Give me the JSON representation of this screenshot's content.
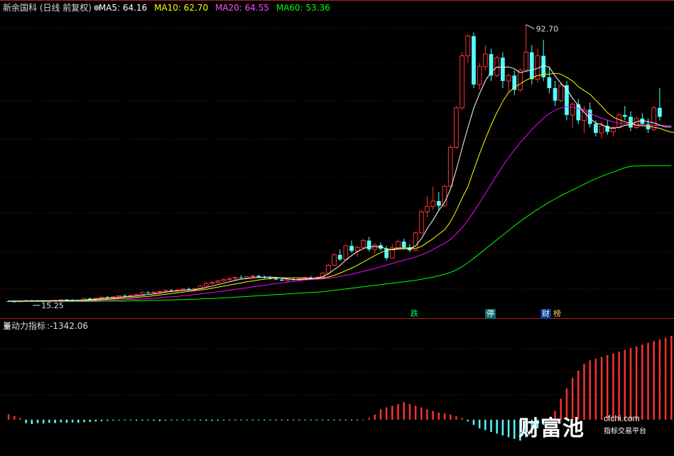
{
  "header": {
    "title": "新余国科 (日线 前复权)",
    "ma5": "MA5: 64.16",
    "ma10": "MA10: 62.70",
    "ma20": "MA20: 64.55",
    "ma60": "MA60: 53.36"
  },
  "indicator": {
    "title": "量动力指标",
    "value": ":-1342.06"
  },
  "price_annotations": {
    "high": "92.70",
    "low": "15.25"
  },
  "markers": {
    "fall": "跌",
    "limit": "停",
    "finance": "财",
    "list": "榜"
  },
  "watermark": {
    "brand": "财富池",
    "url": "cfchi.com",
    "sub": "指标交易平台"
  },
  "colors": {
    "background": "#000000",
    "up": "#ff3232",
    "down": "#54ffff",
    "ma5": "#ffffff",
    "ma10": "#ffff00",
    "ma20": "#ff00ff",
    "ma60": "#00ff00",
    "grid": "#7a1010"
  },
  "chart_data": {
    "type": "candlestick",
    "price_range": [
      14,
      96
    ],
    "indicator_range": [
      -2000,
      5000
    ],
    "bars": [
      [
        15.6,
        15.8,
        15.3,
        15.5
      ],
      [
        15.5,
        15.6,
        15.2,
        15.3
      ],
      [
        15.4,
        15.7,
        15.3,
        15.6
      ],
      [
        15.6,
        15.9,
        15.5,
        15.8
      ],
      [
        15.8,
        16.0,
        15.6,
        15.7
      ],
      [
        15.7,
        15.9,
        15.5,
        15.6
      ],
      [
        15.6,
        15.8,
        15.4,
        15.5
      ],
      [
        15.5,
        15.7,
        15.3,
        15.6
      ],
      [
        15.6,
        15.9,
        15.5,
        15.8
      ],
      [
        15.8,
        16.1,
        15.7,
        16.0
      ],
      [
        16.0,
        16.2,
        15.8,
        15.9
      ],
      [
        15.9,
        16.1,
        15.7,
        15.8
      ],
      [
        15.8,
        16.0,
        15.6,
        15.9
      ],
      [
        15.9,
        16.4,
        15.8,
        16.3
      ],
      [
        16.3,
        16.6,
        16.1,
        16.2
      ],
      [
        16.2,
        16.5,
        16.0,
        16.4
      ],
      [
        16.4,
        16.8,
        16.3,
        16.7
      ],
      [
        16.7,
        17.0,
        16.5,
        16.6
      ],
      [
        16.6,
        16.9,
        16.4,
        16.8
      ],
      [
        16.8,
        17.2,
        16.7,
        17.1
      ],
      [
        17.1,
        17.4,
        16.9,
        17.0
      ],
      [
        17.0,
        17.3,
        16.8,
        17.2
      ],
      [
        17.2,
        17.6,
        17.1,
        17.5
      ],
      [
        17.5,
        18.2,
        17.4,
        18.0
      ],
      [
        18.0,
        18.4,
        17.7,
        17.9
      ],
      [
        17.9,
        18.3,
        17.6,
        18.1
      ],
      [
        18.1,
        18.5,
        17.9,
        18.3
      ],
      [
        18.3,
        18.8,
        18.1,
        18.6
      ],
      [
        18.6,
        19.0,
        18.3,
        18.5
      ],
      [
        18.5,
        18.9,
        18.2,
        18.7
      ],
      [
        18.7,
        19.2,
        18.5,
        19.0
      ],
      [
        19.0,
        19.4,
        18.7,
        18.8
      ],
      [
        18.8,
        19.3,
        18.6,
        19.1
      ],
      [
        19.1,
        20.0,
        19.0,
        19.8
      ],
      [
        19.8,
        21.0,
        19.6,
        20.5
      ],
      [
        20.5,
        21.2,
        20.2,
        20.8
      ],
      [
        20.8,
        21.5,
        20.5,
        21.2
      ],
      [
        21.2,
        22.0,
        21.0,
        21.6
      ],
      [
        21.6,
        22.3,
        21.2,
        21.9
      ],
      [
        21.9,
        22.5,
        21.5,
        22.2
      ],
      [
        22.2,
        22.8,
        21.9,
        22.0
      ],
      [
        22.0,
        22.6,
        21.7,
        22.4
      ],
      [
        22.4,
        22.9,
        22.1,
        22.6
      ],
      [
        22.6,
        23.0,
        22.2,
        22.3
      ],
      [
        22.3,
        22.7,
        21.9,
        22.1
      ],
      [
        22.1,
        22.5,
        21.6,
        21.8
      ],
      [
        21.8,
        22.2,
        21.4,
        21.6
      ],
      [
        21.6,
        22.0,
        21.2,
        21.3
      ],
      [
        21.3,
        21.9,
        21.0,
        21.7
      ],
      [
        21.7,
        22.1,
        21.3,
        21.5
      ],
      [
        21.5,
        22.0,
        21.2,
        21.8
      ],
      [
        21.8,
        22.4,
        21.6,
        22.2
      ],
      [
        22.2,
        22.6,
        21.9,
        22.0
      ],
      [
        22.0,
        22.5,
        21.8,
        22.3
      ],
      [
        22.3,
        23.6,
        22.2,
        23.4
      ],
      [
        23.4,
        26.0,
        23.2,
        25.6
      ],
      [
        25.6,
        29.0,
        25.4,
        28.5
      ],
      [
        28.5,
        30.0,
        26.8,
        27.2
      ],
      [
        27.2,
        31.5,
        27.0,
        31.0
      ],
      [
        31.0,
        32.5,
        29.0,
        29.6
      ],
      [
        29.6,
        31.0,
        28.0,
        30.6
      ],
      [
        30.6,
        33.0,
        30.2,
        32.5
      ],
      [
        32.5,
        33.5,
        29.5,
        30.0
      ],
      [
        30.0,
        31.8,
        28.8,
        31.2
      ],
      [
        31.2,
        32.0,
        29.6,
        30.2
      ],
      [
        30.2,
        31.0,
        27.0,
        27.6
      ],
      [
        27.6,
        31.5,
        27.4,
        30.5
      ],
      [
        30.5,
        32.8,
        30.0,
        32.2
      ],
      [
        32.2,
        33.0,
        30.0,
        30.6
      ],
      [
        30.6,
        31.5,
        29.2,
        29.8
      ],
      [
        29.8,
        35.0,
        29.6,
        34.6
      ],
      [
        34.6,
        41.0,
        34.4,
        40.5
      ],
      [
        40.5,
        45.0,
        39.0,
        42.0
      ],
      [
        42.0,
        47.5,
        41.0,
        43.5
      ],
      [
        43.5,
        46.0,
        41.0,
        42.2
      ],
      [
        42.2,
        48.0,
        42.0,
        47.6
      ],
      [
        47.6,
        59.0,
        47.4,
        58.5
      ],
      [
        58.5,
        70.0,
        58.0,
        69.5
      ],
      [
        69.5,
        85.0,
        69.0,
        84.0
      ],
      [
        84.0,
        90.0,
        82.0,
        89.5
      ],
      [
        89.5,
        90.5,
        75.0,
        76.0
      ],
      [
        76.0,
        82.0,
        74.5,
        81.0
      ],
      [
        81.0,
        87.0,
        80.0,
        84.5
      ],
      [
        84.5,
        86.0,
        77.0,
        78.5
      ],
      [
        78.5,
        84.0,
        78.0,
        83.5
      ],
      [
        83.5,
        85.0,
        75.0,
        77.0
      ],
      [
        77.0,
        79.0,
        74.0,
        78.5
      ],
      [
        78.5,
        80.0,
        73.0,
        74.5
      ],
      [
        74.5,
        80.5,
        74.0,
        80.0
      ],
      [
        80.0,
        92.7,
        79.5,
        85.0
      ],
      [
        85.0,
        87.0,
        76.0,
        77.5
      ],
      [
        77.5,
        86.0,
        76.5,
        84.0
      ],
      [
        84.0,
        88.5,
        77.0,
        78.0
      ],
      [
        78.0,
        81.0,
        73.5,
        75.0
      ],
      [
        75.0,
        77.0,
        70.0,
        71.5
      ],
      [
        71.5,
        76.5,
        71.0,
        75.8
      ],
      [
        75.8,
        77.0,
        66.0,
        67.5
      ],
      [
        67.5,
        71.0,
        64.0,
        70.5
      ],
      [
        70.5,
        72.0,
        65.0,
        66.0
      ],
      [
        66.0,
        70.0,
        62.5,
        69.0
      ],
      [
        69.0,
        71.0,
        64.0,
        65.0
      ],
      [
        65.0,
        66.0,
        61.5,
        62.5
      ],
      [
        62.5,
        65.5,
        61.0,
        64.5
      ],
      [
        64.5,
        66.0,
        62.0,
        62.8
      ],
      [
        62.8,
        64.5,
        61.5,
        64.0
      ],
      [
        64.0,
        68.0,
        63.5,
        67.5
      ],
      [
        67.5,
        70.0,
        66.0,
        67.0
      ],
      [
        67.0,
        68.5,
        63.0,
        64.0
      ],
      [
        64.0,
        67.0,
        63.5,
        66.5
      ],
      [
        66.5,
        68.0,
        64.5,
        65.0
      ],
      [
        65.0,
        66.5,
        62.5,
        63.5
      ],
      [
        63.5,
        70.0,
        63.0,
        69.5
      ],
      [
        69.5,
        75.0,
        66.0,
        67.0
      ]
    ],
    "ma5": [
      15.6,
      15.6,
      15.6,
      15.6,
      15.6,
      15.7,
      15.7,
      15.7,
      15.7,
      15.7,
      15.8,
      15.8,
      15.8,
      15.9,
      16.0,
      16.1,
      16.3,
      16.4,
      16.5,
      16.6,
      16.8,
      16.9,
      17.0,
      17.2,
      17.4,
      17.6,
      17.8,
      18.1,
      18.3,
      18.4,
      18.6,
      18.7,
      18.8,
      19.1,
      19.4,
      19.8,
      20.2,
      20.6,
      21.0,
      21.4,
      21.7,
      21.9,
      22.1,
      22.2,
      22.3,
      22.3,
      22.2,
      22.0,
      21.8,
      21.6,
      21.6,
      21.7,
      21.8,
      22.0,
      22.4,
      23.2,
      24.4,
      25.5,
      27.1,
      28.3,
      29.4,
      30.2,
      30.8,
      30.8,
      30.7,
      30.2,
      29.9,
      30.1,
      30.2,
      30.2,
      31.0,
      33.0,
      35.8,
      38.2,
      40.9,
      43.1,
      46.8,
      52.2,
      58.2,
      64.0,
      69.4,
      73.4,
      77.0,
      79.5,
      80.9,
      80.8,
      80.9,
      80.4,
      79.3,
      79.7,
      80.1,
      80.5,
      81.3,
      80.8,
      78.4,
      76.4,
      74.7,
      72.2,
      70.2,
      68.2,
      66.6,
      65.2,
      64.9,
      64.0,
      63.8,
      64.1,
      64.6,
      64.8,
      65.6,
      66.0,
      65.6,
      65.3,
      64.7,
      64.16,
      64.16
    ],
    "ma10": [
      15.6,
      15.6,
      15.6,
      15.6,
      15.6,
      15.6,
      15.6,
      15.7,
      15.7,
      15.7,
      15.7,
      15.7,
      15.8,
      15.8,
      15.8,
      15.9,
      16.0,
      16.1,
      16.2,
      16.3,
      16.4,
      16.5,
      16.6,
      16.8,
      16.9,
      17.1,
      17.3,
      17.5,
      17.7,
      17.9,
      18.1,
      18.3,
      18.5,
      18.7,
      18.9,
      19.2,
      19.5,
      19.8,
      20.1,
      20.4,
      20.7,
      21.0,
      21.2,
      21.5,
      21.7,
      21.9,
      22.0,
      22.1,
      22.1,
      22.1,
      22.1,
      22.0,
      21.9,
      21.9,
      22.0,
      22.3,
      22.8,
      23.4,
      24.1,
      24.8,
      25.6,
      26.5,
      27.4,
      28.3,
      29.1,
      29.7,
      30.1,
      30.4,
      30.5,
      30.4,
      30.3,
      30.8,
      31.9,
      33.0,
      34.3,
      35.5,
      37.7,
      40.8,
      44.3,
      47.5,
      52.1,
      56.6,
      60.8,
      64.7,
      68.2,
      71.3,
      73.8,
      75.2,
      76.2,
      77.2,
      77.9,
      78.5,
      78.8,
      78.9,
      79.1,
      78.9,
      78.0,
      77.0,
      75.4,
      74.3,
      73.3,
      71.6,
      70.0,
      68.2,
      66.9,
      66.2,
      65.6,
      65.1,
      64.6,
      64.5,
      64.4,
      64.1,
      63.8,
      63.2,
      62.7,
      62.7
    ],
    "ma20": [
      15.6,
      15.6,
      15.6,
      15.6,
      15.6,
      15.6,
      15.6,
      15.6,
      15.6,
      15.6,
      15.6,
      15.7,
      15.7,
      15.7,
      15.7,
      15.7,
      15.8,
      15.8,
      15.9,
      15.9,
      16.0,
      16.1,
      16.1,
      16.2,
      16.3,
      16.4,
      16.5,
      16.7,
      16.8,
      16.9,
      17.1,
      17.2,
      17.4,
      17.6,
      17.8,
      18.0,
      18.2,
      18.4,
      18.6,
      18.9,
      19.1,
      19.3,
      19.6,
      19.8,
      20.0,
      20.3,
      20.5,
      20.7,
      20.9,
      21.1,
      21.3,
      21.5,
      21.6,
      21.7,
      21.8,
      22.0,
      22.2,
      22.5,
      22.8,
      23.1,
      23.5,
      23.9,
      24.3,
      24.7,
      25.2,
      25.6,
      26.1,
      26.6,
      27.0,
      27.4,
      27.9,
      28.5,
      29.2,
      30.0,
      30.9,
      31.7,
      32.8,
      34.3,
      36.1,
      38.1,
      40.5,
      43.0,
      45.6,
      48.2,
      50.8,
      53.3,
      55.6,
      57.8,
      59.8,
      61.6,
      63.4,
      65.1,
      66.6,
      67.9,
      68.8,
      69.5,
      69.8,
      69.7,
      69.3,
      68.7,
      68.0,
      67.2,
      66.6,
      66.1,
      65.6,
      65.2,
      65.0,
      64.9,
      64.8,
      64.7,
      64.7,
      64.6,
      64.6,
      64.55,
      64.55
    ],
    "ma60": [
      15.5,
      15.5,
      15.5,
      15.5,
      15.5,
      15.5,
      15.5,
      15.5,
      15.5,
      15.5,
      15.5,
      15.5,
      15.5,
      15.5,
      15.5,
      15.5,
      15.6,
      15.6,
      15.6,
      15.6,
      15.6,
      15.7,
      15.7,
      15.7,
      15.8,
      15.8,
      15.8,
      15.9,
      15.9,
      16.0,
      16.0,
      16.1,
      16.1,
      16.2,
      16.3,
      16.3,
      16.4,
      16.5,
      16.6,
      16.7,
      16.8,
      16.9,
      17.0,
      17.1,
      17.2,
      17.3,
      17.4,
      17.5,
      17.6,
      17.7,
      17.8,
      17.9,
      18.0,
      18.1,
      18.2,
      18.4,
      18.6,
      18.8,
      19.0,
      19.2,
      19.4,
      19.6,
      19.8,
      20.0,
      20.2,
      20.4,
      20.6,
      20.8,
      21.0,
      21.2,
      21.4,
      21.7,
      22.0,
      22.3,
      22.7,
      23.1,
      23.6,
      24.3,
      25.2,
      26.3,
      27.5,
      28.8,
      30.1,
      31.4,
      32.7,
      34.0,
      35.3,
      36.6,
      37.8,
      39.0,
      40.1,
      41.2,
      42.2,
      43.2,
      44.1,
      45.0,
      45.8,
      46.6,
      47.4,
      48.2,
      49.0,
      49.7,
      50.4,
      51.0,
      51.6,
      52.2,
      52.8,
      53.2,
      53.3,
      53.3,
      53.36,
      53.36,
      53.36,
      53.36,
      53.36
    ],
    "indicator": [
      300,
      200,
      100,
      -200,
      -250,
      -200,
      -220,
      -180,
      -200,
      -150,
      -180,
      -160,
      -180,
      -150,
      -130,
      -100,
      -80,
      -60,
      -50,
      -40,
      -40,
      -40,
      -60,
      -50,
      -40,
      -60,
      -80,
      -50,
      -30,
      -20,
      -20,
      -30,
      -40,
      -50,
      -60,
      -60,
      -50,
      -40,
      -30,
      -20,
      -10,
      -20,
      -30,
      -20,
      -10,
      -20,
      -30,
      -30,
      -20,
      -10,
      -30,
      -40,
      -20,
      -10,
      -30,
      -20,
      -10,
      -10,
      -20,
      -20,
      -10,
      0,
      100,
      300,
      600,
      700,
      800,
      900,
      1000,
      900,
      800,
      700,
      600,
      500,
      400,
      350,
      300,
      200,
      100,
      -100,
      -300,
      -500,
      -600,
      -700,
      -800,
      -900,
      -1000,
      -1100,
      -1200,
      -1000,
      -800,
      -500,
      -300,
      0,
      500,
      1200,
      1800,
      2400,
      2800,
      3200,
      3400,
      3500,
      3600,
      3700,
      3800,
      3900,
      4000,
      4100,
      4200,
      4300,
      4400,
      4500,
      4600,
      4700,
      4800,
      4900
    ]
  }
}
